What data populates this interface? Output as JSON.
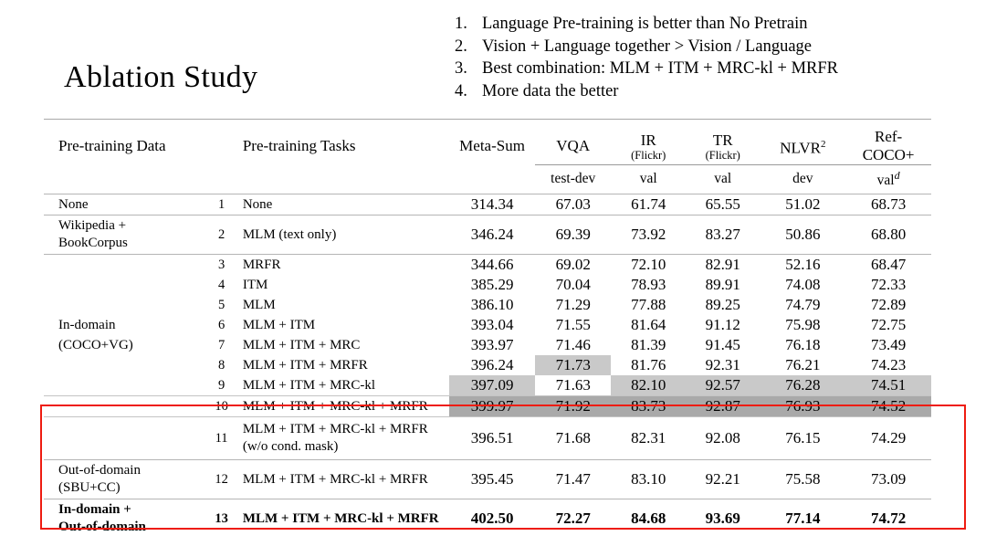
{
  "slide": {
    "title": "Ablation Study"
  },
  "bullets": [
    {
      "num": "1.",
      "text": "Language Pre-training is better than No Pretrain"
    },
    {
      "num": "2.",
      "text": "Vision + Language together > Vision / Language"
    },
    {
      "num": "3.",
      "text": "Best combination: MLM + ITM + MRC-kl + MRFR"
    },
    {
      "num": "4.",
      "text": "More data the better"
    }
  ],
  "table": {
    "headers": {
      "data": "Pre-training Data",
      "tasks": "Pre-training Tasks",
      "meta_sum": "Meta-Sum",
      "vqa": "VQA",
      "ir": "IR",
      "ir_sub": "(Flickr)",
      "tr": "TR",
      "tr_sub": "(Flickr)",
      "nlvr": "NLVR",
      "nlvr_sup": "2",
      "ref1": "Ref-",
      "ref2": "COCO+"
    },
    "subheaders": {
      "vqa": "test-dev",
      "ir": "val",
      "tr": "val",
      "nlvr": "dev",
      "ref": "val",
      "ref_sup": "d"
    },
    "rows": [
      {
        "data": "None",
        "idx": "1",
        "task": "None",
        "meta": "314.34",
        "vqa": "67.03",
        "ir": "61.74",
        "tr": "65.55",
        "nlvr": "51.02",
        "ref": "68.73"
      },
      {
        "data": "Wikipedia +\nBookCorpus",
        "idx": "2",
        "task": "MLM (text only)",
        "meta": "346.24",
        "vqa": "69.39",
        "ir": "73.92",
        "tr": "83.27",
        "nlvr": "50.86",
        "ref": "68.80"
      },
      {
        "data": "",
        "idx": "3",
        "task": "MRFR",
        "meta": "344.66",
        "vqa": "69.02",
        "ir": "72.10",
        "tr": "82.91",
        "nlvr": "52.16",
        "ref": "68.47"
      },
      {
        "data": "",
        "idx": "4",
        "task": "ITM",
        "meta": "385.29",
        "vqa": "70.04",
        "ir": "78.93",
        "tr": "89.91",
        "nlvr": "74.08",
        "ref": "72.33"
      },
      {
        "data": "",
        "idx": "5",
        "task": "MLM",
        "meta": "386.10",
        "vqa": "71.29",
        "ir": "77.88",
        "tr": "89.25",
        "nlvr": "74.79",
        "ref": "72.89"
      },
      {
        "data": "In-domain",
        "idx": "6",
        "task": "MLM + ITM",
        "meta": "393.04",
        "vqa": "71.55",
        "ir": "81.64",
        "tr": "91.12",
        "nlvr": "75.98",
        "ref": "72.75"
      },
      {
        "data": "(COCO+VG)",
        "idx": "7",
        "task": "MLM + ITM + MRC",
        "meta": "393.97",
        "vqa": "71.46",
        "ir": "81.39",
        "tr": "91.45",
        "nlvr": "76.18",
        "ref": "73.49"
      },
      {
        "data": "",
        "idx": "8",
        "task": "MLM + ITM + MRFR",
        "meta": "396.24",
        "vqa": "71.73",
        "ir": "81.76",
        "tr": "92.31",
        "nlvr": "76.21",
        "ref": "74.23"
      },
      {
        "data": "",
        "idx": "9",
        "task": "MLM + ITM + MRC-kl",
        "meta": "397.09",
        "vqa": "71.63",
        "ir": "82.10",
        "tr": "92.57",
        "nlvr": "76.28",
        "ref": "74.51"
      },
      {
        "data": "",
        "idx": "10",
        "task": "MLM + ITM + MRC-kl + MRFR",
        "meta": "399.97",
        "vqa": "71.92",
        "ir": "83.73",
        "tr": "92.87",
        "nlvr": "76.93",
        "ref": "74.52"
      },
      {
        "data": "",
        "idx": "11",
        "task": "MLM + ITM + MRC-kl + MRFR\n(w/o cond. mask)",
        "meta": "396.51",
        "vqa": "71.68",
        "ir": "82.31",
        "tr": "92.08",
        "nlvr": "76.15",
        "ref": "74.29"
      },
      {
        "data": "Out-of-domain\n(SBU+CC)",
        "idx": "12",
        "task": "MLM + ITM + MRC-kl + MRFR",
        "meta": "395.45",
        "vqa": "71.47",
        "ir": "83.10",
        "tr": "92.21",
        "nlvr": "75.58",
        "ref": "73.09"
      },
      {
        "data": "In-domain +\nOut-of-domain",
        "idx": "13",
        "task": "MLM + ITM + MRC-kl + MRFR",
        "meta": "402.50",
        "vqa": "72.27",
        "ir": "84.68",
        "tr": "93.69",
        "nlvr": "77.14",
        "ref": "74.72"
      }
    ]
  },
  "colors": {
    "highlight_light": "#c9c9c9",
    "highlight_dark": "#a9a9a9",
    "callout_red": "#ee1c11",
    "rule_gray": "#a9a9a9"
  }
}
